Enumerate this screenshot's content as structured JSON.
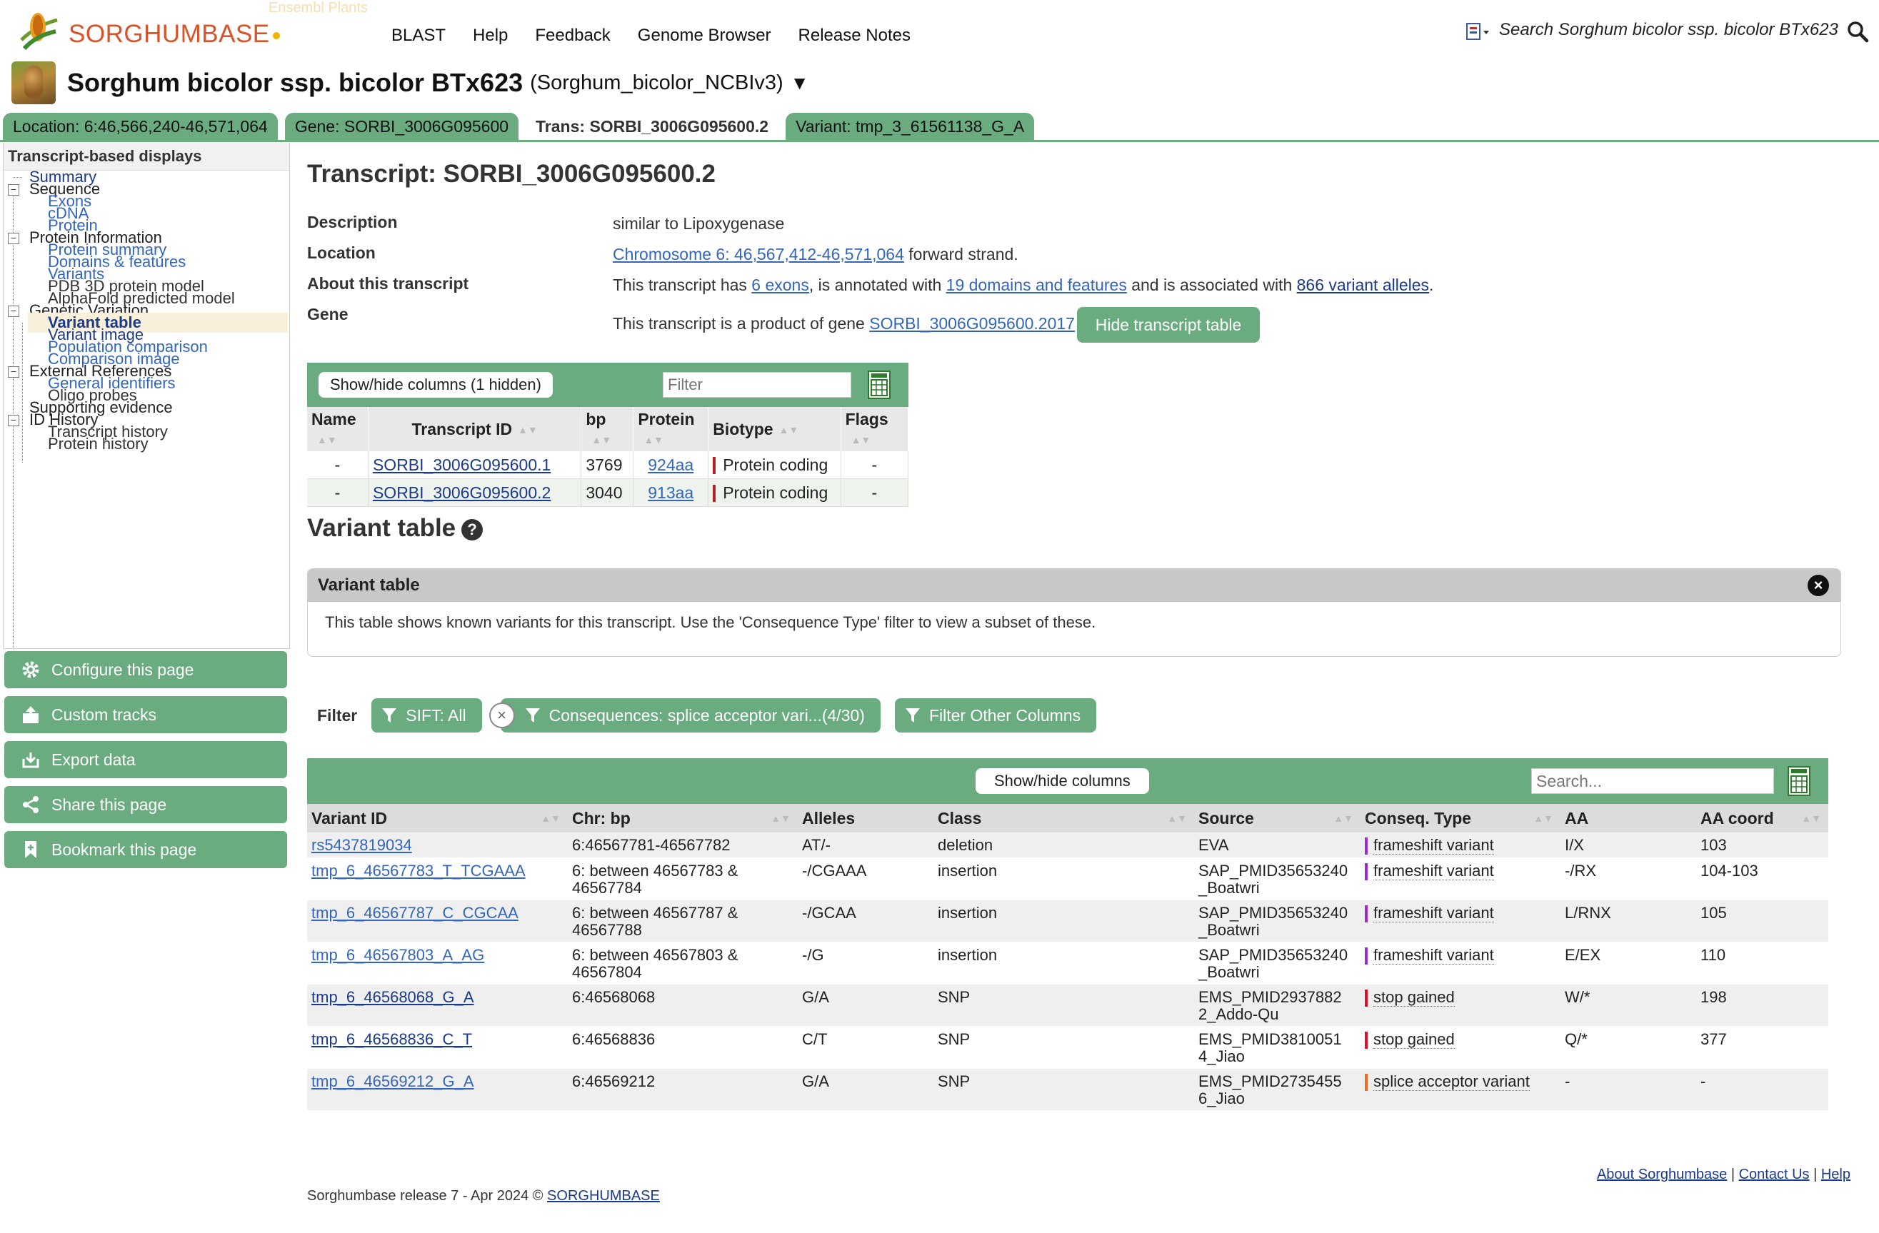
{
  "header": {
    "logo_text": "SORGHUMBASE",
    "logo_faint": "Ensembl Plants",
    "nav": [
      "BLAST",
      "Help",
      "Feedback",
      "Genome Browser",
      "Release Notes"
    ],
    "search_placeholder": "Search Sorghum bicolor ssp. bicolor BTx623"
  },
  "species": {
    "name": "Sorghum bicolor ssp. bicolor BTx623",
    "assembly": "(Sorghum_bicolor_NCBIv3)",
    "caret": "▼"
  },
  "tabs": [
    {
      "label": "Location: 6:46,566,240-46,571,064",
      "active": false
    },
    {
      "label": "Gene: SORBI_3006G095600",
      "active": false
    },
    {
      "label": "Trans: SORBI_3006G095600.2",
      "active": true
    },
    {
      "label": "Variant: tmp_3_61561138_G_A",
      "active": false
    }
  ],
  "sidebar": {
    "title": "Transcript-based displays",
    "items": {
      "summary": "Summary",
      "sequence": "Sequence",
      "exons": "Exons",
      "cdna": "cDNA",
      "protein": "Protein",
      "protein_info": "Protein Information",
      "protein_summary": "Protein summary",
      "domains": "Domains & features",
      "variants": "Variants",
      "pdb": "PDB 3D protein model",
      "alphafold": "AlphaFold predicted model",
      "genetic_variation": "Genetic Variation",
      "variant_table": "Variant table",
      "variant_image": "Variant image",
      "population_comparison": "Population comparison",
      "comparison_image": "Comparison image",
      "external_refs": "External References",
      "general_ids": "General identifiers",
      "oligo": "Oligo probes",
      "supporting": "Supporting evidence",
      "id_history": "ID History",
      "transcript_history": "Transcript history",
      "protein_history": "Protein history"
    },
    "buttons": {
      "configure": "Configure this page",
      "custom_tracks": "Custom tracks",
      "export": "Export data",
      "share": "Share this page",
      "bookmark": "Bookmark this page"
    }
  },
  "transcript": {
    "title": "Transcript: SORBI_3006G095600.2",
    "labels": {
      "description": "Description",
      "location": "Location",
      "about": "About this transcript",
      "gene": "Gene"
    },
    "description": "similar to Lipoxygenase",
    "location_link": "Chromosome 6: 46,567,412-46,571,064",
    "location_suffix": " forward strand.",
    "about": {
      "p1": "This transcript has ",
      "exons": "6 exons",
      "p2": ", is annotated with ",
      "domains": "19 domains and features",
      "p3": " and is associated with ",
      "alleles": "866 variant alleles",
      "p4": "."
    },
    "gene_prefix": "This transcript is a product of gene ",
    "gene_link": "SORBI_3006G095600.2017",
    "hide_button": "Hide transcript table"
  },
  "transcript_table": {
    "showhide": "Show/hide columns (1 hidden)",
    "filter_placeholder": "Filter",
    "headers": [
      "Name",
      "Transcript ID",
      "bp",
      "Protein",
      "Biotype",
      "Flags"
    ],
    "rows": [
      {
        "name": "-",
        "id": "SORBI_3006G095600.1",
        "bp": "3769",
        "protein": "924aa",
        "biotype": "Protein coding",
        "flags": "-"
      },
      {
        "name": "-",
        "id": "SORBI_3006G095600.2",
        "bp": "3040",
        "protein": "913aa",
        "biotype": "Protein coding",
        "flags": "-"
      }
    ]
  },
  "variant_section": {
    "heading": "Variant table",
    "help": "?",
    "panel_title": "Variant table",
    "panel_text": "This table shows known variants for this transcript. Use the 'Consequence Type' filter to view a subset of these.",
    "filter_label": "Filter",
    "filters": {
      "sift": "SIFT: All",
      "consequences": "Consequences: splice acceptor vari...(4/30)",
      "other": "Filter Other Columns"
    },
    "showhide": "Show/hide columns",
    "search_placeholder": "Search...",
    "headers": [
      "Variant ID",
      "Chr: bp",
      "Alleles",
      "Class",
      "Source",
      "Conseq. Type",
      "AA",
      "AA coord"
    ],
    "rows": [
      {
        "id": "rs5437819034",
        "chr_l1": "6:46567781-46567782",
        "chr_l2": "",
        "alleles": "AT/-",
        "class": "deletion",
        "source_l1": "EVA",
        "source_l2": "",
        "conseq": "frameshift variant",
        "conseq_color": "#9a2fc9",
        "aa": "I/X",
        "aa_coord": "103",
        "dark": false
      },
      {
        "id": "tmp_6_46567783_T_TCGAAA",
        "chr_l1": "6: between 46567783 &",
        "chr_l2": "46567784",
        "alleles": "-/CGAAA",
        "class": "insertion",
        "source_l1": "SAP_PMID35653240",
        "source_l2": "_Boatwri",
        "conseq": "frameshift variant",
        "conseq_color": "#9a2fc9",
        "aa": "-/RX",
        "aa_coord": "104-103",
        "dark": false
      },
      {
        "id": "tmp_6_46567787_C_CGCAA",
        "chr_l1": "6: between 46567787 &",
        "chr_l2": "46567788",
        "alleles": "-/GCAA",
        "class": "insertion",
        "source_l1": "SAP_PMID35653240",
        "source_l2": "_Boatwri",
        "conseq": "frameshift variant",
        "conseq_color": "#9a2fc9",
        "aa": "L/RNX",
        "aa_coord": "105",
        "dark": false
      },
      {
        "id": "tmp_6_46567803_A_AG",
        "chr_l1": "6: between 46567803 &",
        "chr_l2": "46567804",
        "alleles": "-/G",
        "class": "insertion",
        "source_l1": "SAP_PMID35653240",
        "source_l2": "_Boatwri",
        "conseq": "frameshift variant",
        "conseq_color": "#9a2fc9",
        "aa": "E/EX",
        "aa_coord": "110",
        "dark": false
      },
      {
        "id": "tmp_6_46568068_G_A",
        "chr_l1": "6:46568068",
        "chr_l2": "",
        "alleles": "G/A",
        "class": "SNP",
        "source_l1": "EMS_PMID2937882",
        "source_l2": "2_Addo-Qu",
        "conseq": "stop gained",
        "conseq_color": "#e0102a",
        "aa": "W/*",
        "aa_coord": "198",
        "dark": true
      },
      {
        "id": "tmp_6_46568836_C_T",
        "chr_l1": "6:46568836",
        "chr_l2": "",
        "alleles": "C/T",
        "class": "SNP",
        "source_l1": "EMS_PMID3810051",
        "source_l2": "4_Jiao",
        "conseq": "stop gained",
        "conseq_color": "#e0102a",
        "aa": "Q/*",
        "aa_coord": "377",
        "dark": true
      },
      {
        "id": "tmp_6_46569212_G_A",
        "chr_l1": "6:46569212",
        "chr_l2": "",
        "alleles": "G/A",
        "class": "SNP",
        "source_l1": "EMS_PMID2735455",
        "source_l2": "6_Jiao",
        "conseq": "splice acceptor variant",
        "conseq_color": "#ef6a1a",
        "aa": "-",
        "aa_coord": "-",
        "dark": false
      }
    ]
  },
  "footer": {
    "release": "Sorghumbase release 7 - Apr 2024 © ",
    "release_link": "SORGHUMBASE",
    "about": "About Sorghumbase",
    "contact": "Contact Us",
    "help": "Help",
    "sep": " | "
  },
  "colors": {
    "accent_green": "#6aac80",
    "logo_orange": "#d7542a",
    "link_blue": "#3366bb"
  }
}
